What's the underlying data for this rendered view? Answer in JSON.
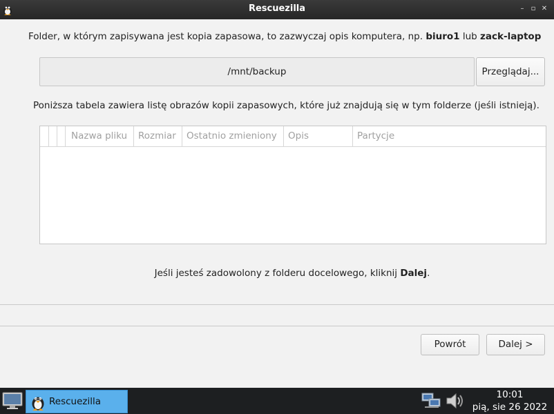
{
  "window": {
    "title": "Rescuezilla",
    "controls": {
      "minimize": "–",
      "maximize": "▫",
      "close": "✕"
    }
  },
  "main": {
    "description_parts": [
      "Folder, w którym zapisywana jest kopia zapasowa, to zazwyczaj opis komputera, np. ",
      "biuro1",
      " lub ",
      "zack-laptop"
    ],
    "path_value": "/mnt/backup",
    "browse_label": "Przeglądaj...",
    "table_description": "Poniższa tabela zawiera listę obrazów kopii zapasowych, które już znajdują się w tym folderze (jeśli istnieją).",
    "table": {
      "columns": [
        "",
        "",
        "Nazwa pliku",
        "Rozmiar",
        "Ostatnio zmieniony",
        "Opis",
        "Partycje"
      ],
      "rows": []
    },
    "confirm_parts": [
      "Jeśli jesteś zadowolony z folderu docelowego, kliknij ",
      "Dalej",
      "."
    ]
  },
  "footer": {
    "back_label": "Powrót",
    "next_label": "Dalej >"
  },
  "taskbar": {
    "desktop_icon": "monitor-icon",
    "task_label": "Rescuezilla",
    "network_icon": "network-icon",
    "volume_icon": "speaker-icon",
    "clock_time": "10:01",
    "clock_date": "pią, sie 26 2022"
  },
  "colors": {
    "titlebar": "#2e2e2e",
    "taskbar": "#1d1f21",
    "task_active": "#5ab0ec",
    "background": "#f2f2f2"
  }
}
